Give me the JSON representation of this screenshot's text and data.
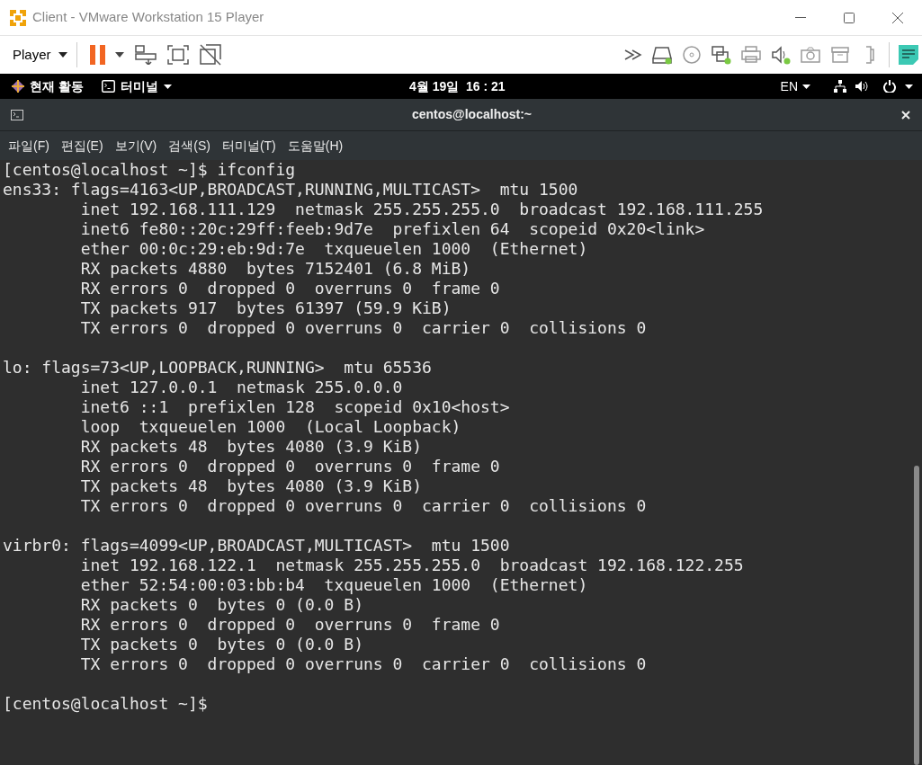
{
  "window": {
    "title": "Client - VMware Workstation 15 Player"
  },
  "toolbar": {
    "menu": "Player",
    "devices": [
      {
        "connected": true
      },
      {
        "connected": false
      },
      {
        "connected": true
      },
      {
        "connected": false
      },
      {
        "connected": true
      },
      {
        "connected": false
      },
      {
        "connected": false
      },
      {
        "connected": false
      }
    ]
  },
  "top_bar": {
    "activities": "현재 활동",
    "app_menu": "터미널",
    "clock": "4월 19일  16 : 21",
    "input_method": "EN"
  },
  "terminal": {
    "title": "centos@localhost:~",
    "menu": [
      "파일(F)",
      "편집(E)",
      "보기(V)",
      "검색(S)",
      "터미널(T)",
      "도움말(H)"
    ],
    "blocks": [
      [
        "[centos@localhost ~]$ ifconfig",
        "ens33: flags=4163<UP,BROADCAST,RUNNING,MULTICAST>  mtu 1500",
        "        inet 192.168.111.129  netmask 255.255.255.0  broadcast 192.168.111.255",
        "        inet6 fe80::20c:29ff:feeb:9d7e  prefixlen 64  scopeid 0x20<link>",
        "        ether 00:0c:29:eb:9d:7e  txqueuelen 1000  (Ethernet)",
        "        RX packets 4880  bytes 7152401 (6.8 MiB)",
        "        RX errors 0  dropped 0  overruns 0  frame 0",
        "        TX packets 917  bytes 61397 (59.9 KiB)",
        "        TX errors 0  dropped 0 overruns 0  carrier 0  collisions 0"
      ],
      [
        "lo: flags=73<UP,LOOPBACK,RUNNING>  mtu 65536",
        "        inet 127.0.0.1  netmask 255.0.0.0",
        "        inet6 ::1  prefixlen 128  scopeid 0x10<host>",
        "        loop  txqueuelen 1000  (Local Loopback)",
        "        RX packets 48  bytes 4080 (3.9 KiB)",
        "        RX errors 0  dropped 0  overruns 0  frame 0",
        "        TX packets 48  bytes 4080 (3.9 KiB)",
        "        TX errors 0  dropped 0 overruns 0  carrier 0  collisions 0"
      ],
      [
        "virbr0: flags=4099<UP,BROADCAST,MULTICAST>  mtu 1500",
        "        inet 192.168.122.1  netmask 255.255.255.0  broadcast 192.168.122.255",
        "        ether 52:54:00:03:bb:b4  txqueuelen 1000  (Ethernet)",
        "        RX packets 0  bytes 0 (0.0 B)",
        "        RX errors 0  dropped 0  overruns 0  frame 0",
        "        TX packets 0  bytes 0 (0.0 B)",
        "        TX errors 0  dropped 0 overruns 0  carrier 0  collisions 0"
      ],
      [
        "[centos@localhost ~]$"
      ]
    ]
  }
}
